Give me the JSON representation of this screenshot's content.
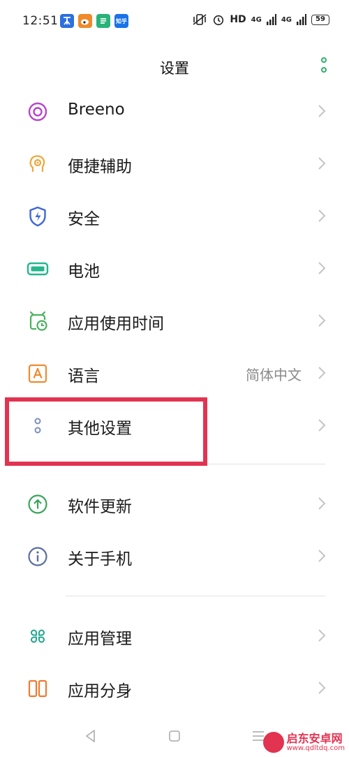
{
  "status_bar": {
    "time": "12:51",
    "network_hd": "HD",
    "network_4g_1": "4G",
    "network_4g_2": "4G",
    "battery_level": "59",
    "notification_icons": [
      "app-notification-icon",
      "weibo-icon",
      "green-app-icon",
      "zhihu-icon"
    ],
    "zhihu_label": "知乎"
  },
  "header": {
    "title": "设置"
  },
  "settings_items": [
    {
      "label": "Breeno",
      "icon": "breeno-icon",
      "color": "#b646c9"
    },
    {
      "label": "便捷辅助",
      "icon": "assist-icon",
      "color": "#f0a63a"
    },
    {
      "label": "安全",
      "icon": "shield-icon",
      "color": "#3e67d6"
    },
    {
      "label": "电池",
      "icon": "battery-icon",
      "color": "#25b68e"
    },
    {
      "label": "应用使用时间",
      "icon": "screen-time-icon",
      "color": "#49b25c"
    },
    {
      "label": "语言",
      "value": "简体中文",
      "icon": "language-icon",
      "color": "#ef8a2f"
    },
    {
      "label": "其他设置",
      "icon": "other-settings-icon",
      "color": "#7b8fbf"
    },
    {
      "label": "软件更新",
      "icon": "update-icon",
      "color": "#3aa55a"
    },
    {
      "label": "关于手机",
      "icon": "info-icon",
      "color": "#5a6ea0"
    },
    {
      "label": "应用管理",
      "icon": "app-management-icon",
      "color": "#1fa58e"
    },
    {
      "label": "应用分身",
      "icon": "app-clone-icon",
      "color": "#ef7a2f"
    }
  ],
  "watermark": {
    "title": "启东安卓网",
    "url": "www.qdltdq.com"
  },
  "colors": {
    "accent": "#2fb06b",
    "highlight": "#e23351"
  }
}
